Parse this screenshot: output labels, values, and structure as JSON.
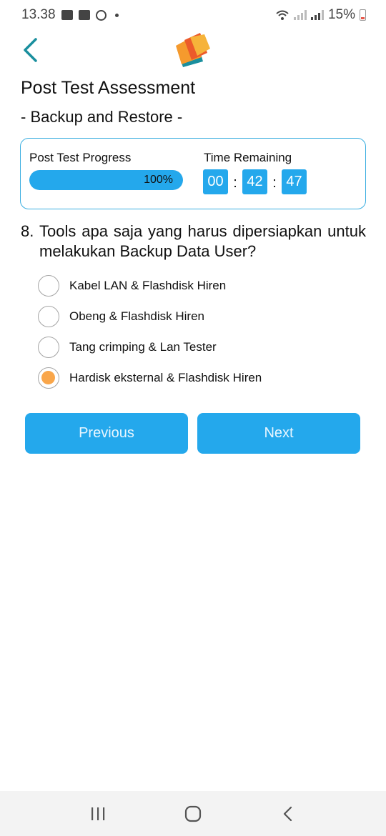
{
  "status_bar": {
    "time": "13.38",
    "battery": "15%",
    "icons": [
      "gallery-icon",
      "youtube-icon",
      "sync-icon",
      "dot-icon",
      "wifi-icon",
      "signal-icon",
      "signal-icon",
      "battery-icon"
    ]
  },
  "header": {
    "back_icon": "chevron-left-icon",
    "logo_icon": "books-logo"
  },
  "page": {
    "title": "Post Test Assessment",
    "subtitle": "- Backup and Restore -"
  },
  "progress_card": {
    "progress_label": "Post Test Progress",
    "progress_value": 1.0,
    "progress_text": "100%",
    "time_label": "Time Remaining",
    "hours": "00",
    "minutes": "42",
    "seconds": "47",
    "separator": ":"
  },
  "question": {
    "number": "8.",
    "text": "Tools apa saja yang harus dipersiapkan untuk melakukan Backup Data User?",
    "options": [
      {
        "label": "Kabel LAN & Flashdisk Hiren",
        "selected": false
      },
      {
        "label": "Obeng & Flashdisk Hiren",
        "selected": false
      },
      {
        "label": "Tang crimping & Lan Tester",
        "selected": false
      },
      {
        "label": "Hardisk eksternal & Flashdisk Hiren",
        "selected": true
      }
    ]
  },
  "navigation": {
    "previous_label": "Previous",
    "next_label": "Next"
  },
  "system_nav": {
    "icons": [
      "recent-apps-icon",
      "home-icon",
      "back-icon"
    ]
  },
  "colors": {
    "accent": "#24a8ec",
    "card_border": "#3aaee0",
    "selected_radio": "#f9a64a",
    "back_chevron": "#1a8f9e"
  }
}
